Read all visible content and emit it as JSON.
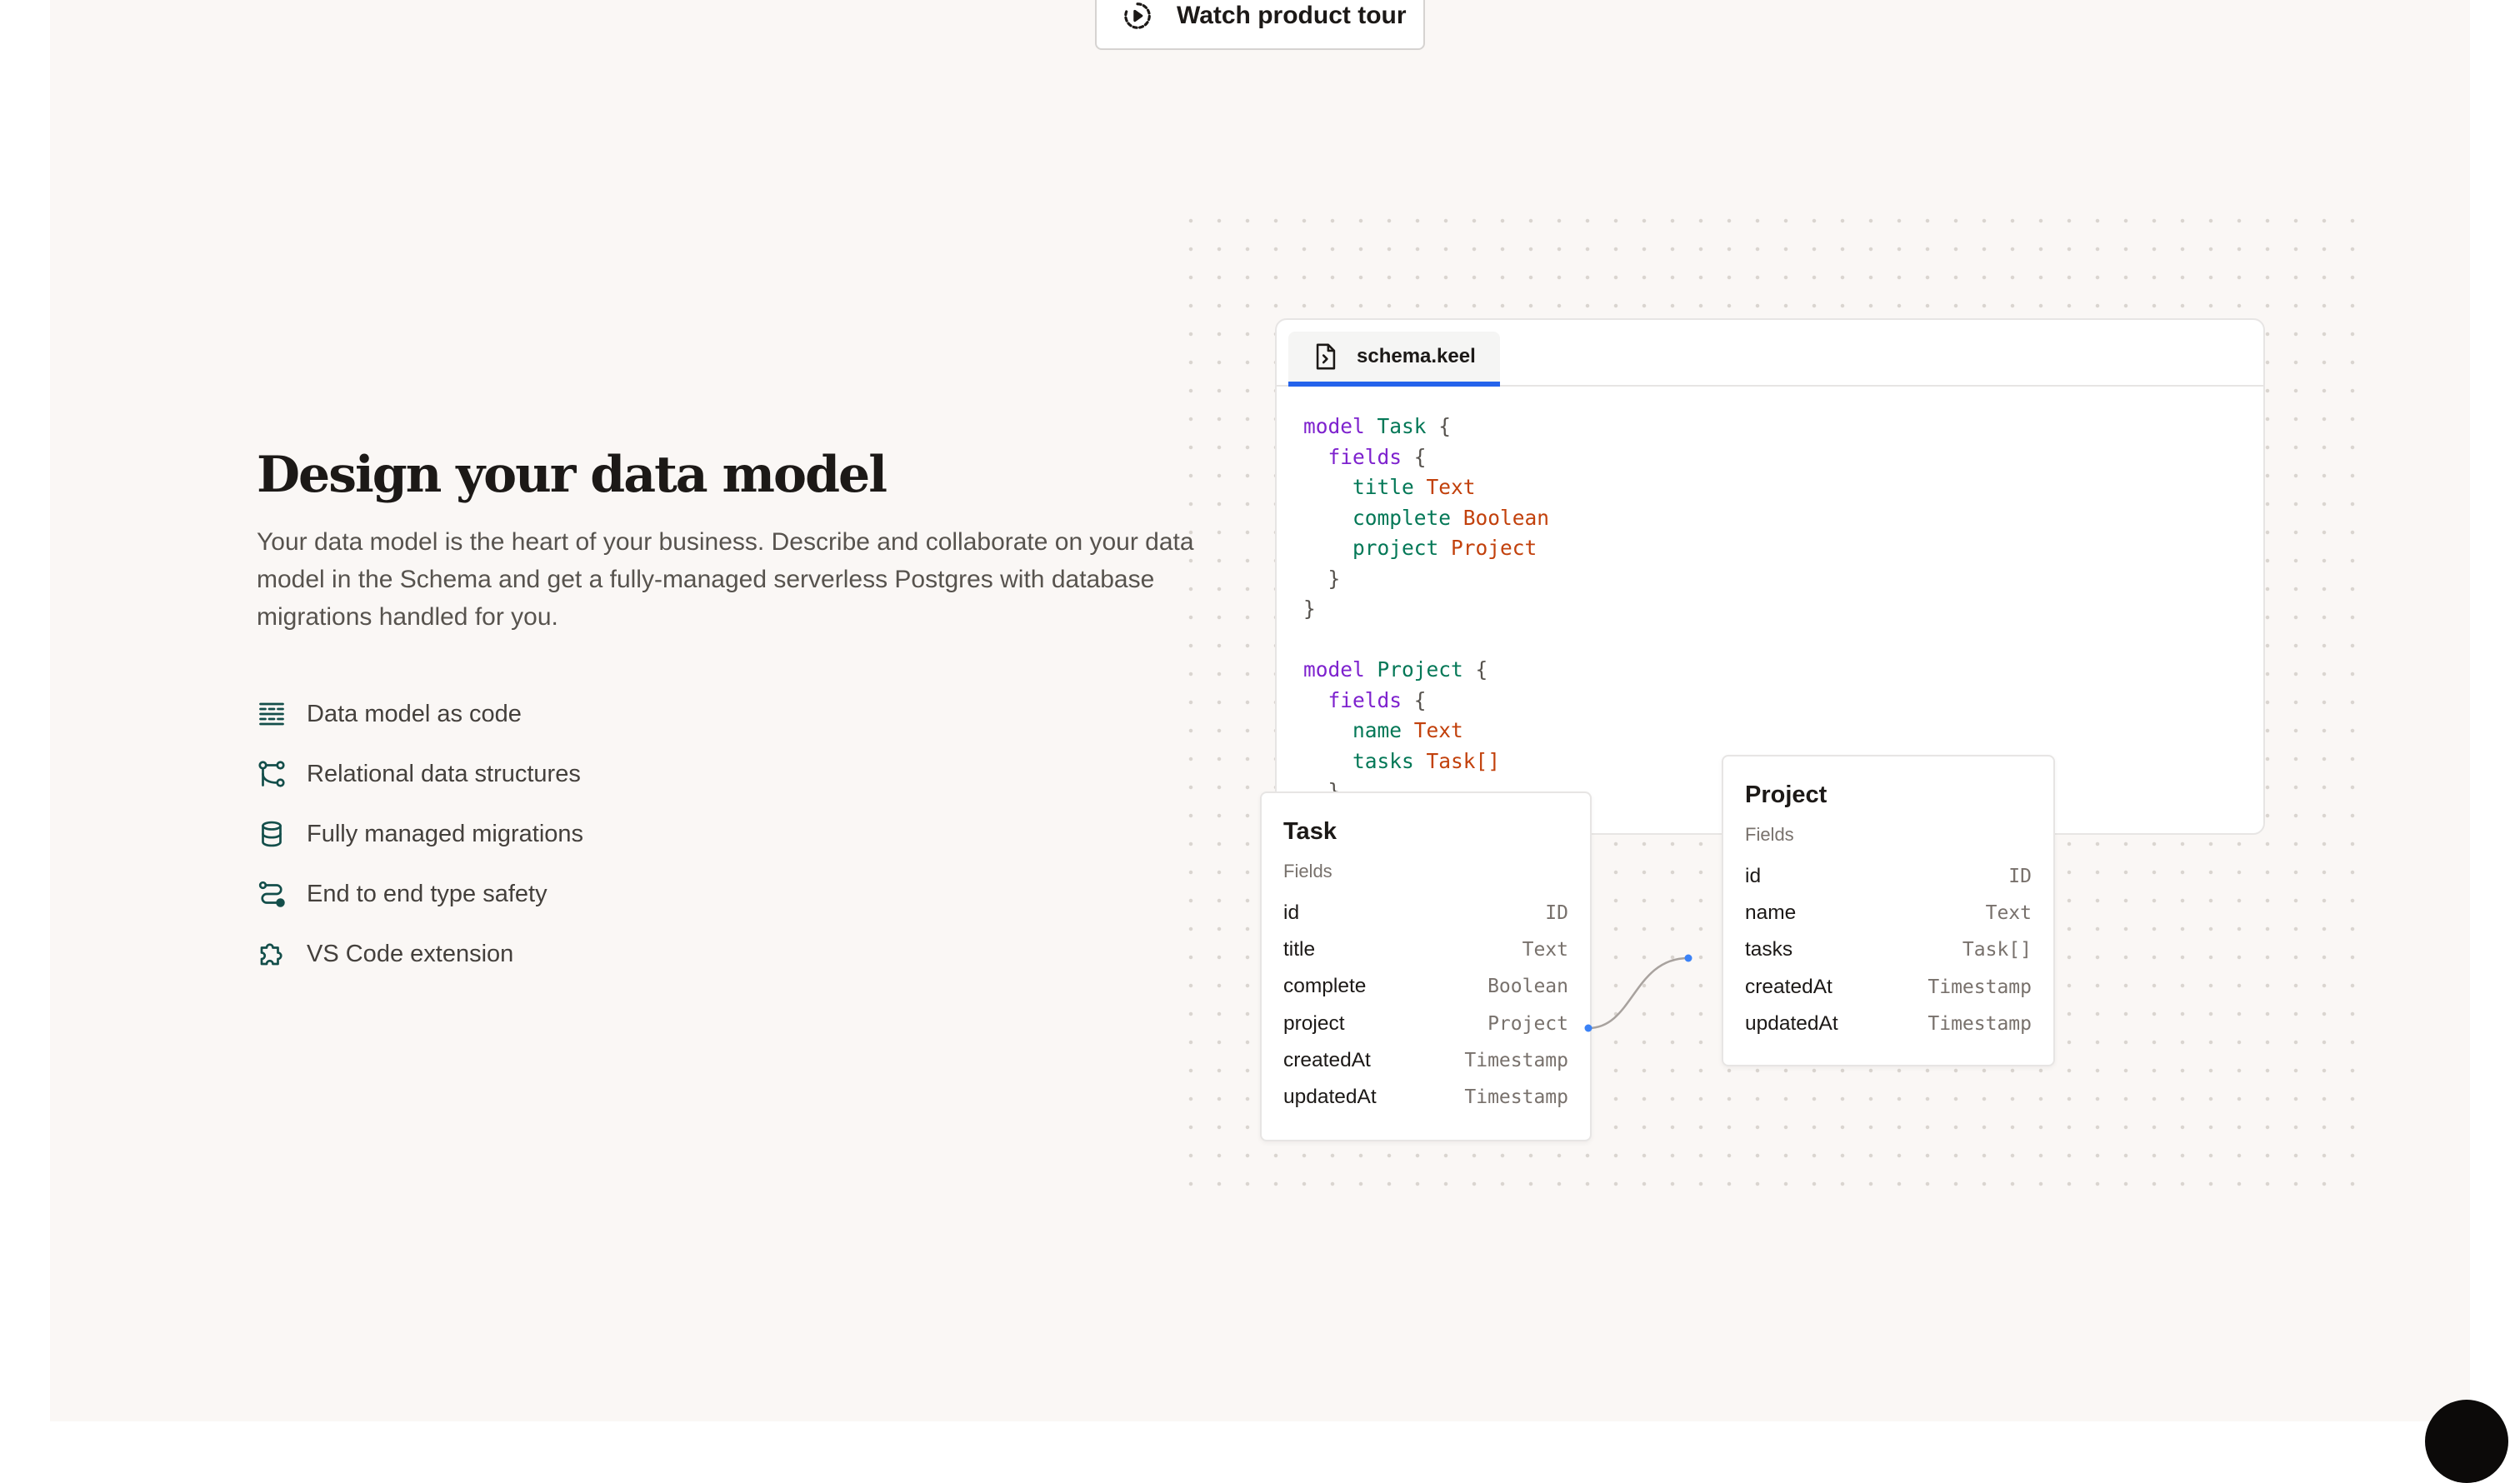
{
  "header": {
    "tour_button_label": "Watch product tour",
    "tour_icon": "play-circle-icon"
  },
  "intro": {
    "title": "Design your data model",
    "description": "Your data model is the heart of your business. Describe and collaborate on your data model in the Schema and get a fully-managed serverless Postgres with database migrations handled for you."
  },
  "features": [
    {
      "label": "Data model as code",
      "icon": "code-grid-icon"
    },
    {
      "label": "Relational data structures",
      "icon": "relations-icon"
    },
    {
      "label": "Fully managed migrations",
      "icon": "database-icon"
    },
    {
      "label": "End to end type safety",
      "icon": "route-icon"
    },
    {
      "label": "VS Code extension",
      "icon": "puzzle-icon"
    }
  ],
  "editor": {
    "tab_label": "schema.keel",
    "tab_icon": "file-code-icon",
    "code_lines": [
      {
        "t": [
          [
            "kw",
            "model "
          ],
          [
            "nm",
            "Task"
          ],
          [
            "br",
            " {"
          ]
        ]
      },
      {
        "t": [
          [
            "br",
            "  "
          ],
          [
            "kw",
            "fields"
          ],
          [
            "br",
            " {"
          ]
        ]
      },
      {
        "t": [
          [
            "br",
            "    "
          ],
          [
            "nm",
            "title"
          ],
          [
            "br",
            " "
          ],
          [
            "ty",
            "Text"
          ]
        ]
      },
      {
        "t": [
          [
            "br",
            "    "
          ],
          [
            "nm",
            "complete"
          ],
          [
            "br",
            " "
          ],
          [
            "ty",
            "Boolean"
          ]
        ]
      },
      {
        "t": [
          [
            "br",
            "    "
          ],
          [
            "nm",
            "project"
          ],
          [
            "br",
            " "
          ],
          [
            "ty",
            "Project"
          ]
        ]
      },
      {
        "t": [
          [
            "br",
            "  }"
          ]
        ]
      },
      {
        "t": [
          [
            "br",
            "}"
          ]
        ]
      },
      {
        "t": [
          [
            "br",
            ""
          ]
        ]
      },
      {
        "t": [
          [
            "kw",
            "model "
          ],
          [
            "nm",
            "Project"
          ],
          [
            "br",
            " {"
          ]
        ]
      },
      {
        "t": [
          [
            "br",
            "  "
          ],
          [
            "kw",
            "fields"
          ],
          [
            "br",
            " {"
          ]
        ]
      },
      {
        "t": [
          [
            "br",
            "    "
          ],
          [
            "nm",
            "name"
          ],
          [
            "br",
            " "
          ],
          [
            "ty",
            "Text"
          ]
        ]
      },
      {
        "t": [
          [
            "br",
            "    "
          ],
          [
            "nm",
            "tasks"
          ],
          [
            "br",
            " "
          ],
          [
            "ty",
            "Task[]"
          ]
        ]
      },
      {
        "t": [
          [
            "br",
            "  }"
          ]
        ]
      }
    ]
  },
  "models": {
    "task": {
      "title": "Task",
      "subtitle": "Fields",
      "fields": [
        {
          "name": "id",
          "type": "ID"
        },
        {
          "name": "title",
          "type": "Text"
        },
        {
          "name": "complete",
          "type": "Boolean"
        },
        {
          "name": "project",
          "type": "Project"
        },
        {
          "name": "createdAt",
          "type": "Timestamp"
        },
        {
          "name": "updatedAt",
          "type": "Timestamp"
        }
      ]
    },
    "project": {
      "title": "Project",
      "subtitle": "Fields",
      "fields": [
        {
          "name": "id",
          "type": "ID"
        },
        {
          "name": "name",
          "type": "Text"
        },
        {
          "name": "tasks",
          "type": "Task[]"
        },
        {
          "name": "createdAt",
          "type": "Timestamp"
        },
        {
          "name": "updatedAt",
          "type": "Timestamp"
        }
      ]
    }
  },
  "colors": {
    "page_bg": "#faf7f5",
    "keyword": "#7e22ce",
    "identifier": "#047857",
    "type": "#c2410c",
    "tab_accent": "#2563eb",
    "icon_green": "#134e4a",
    "connector": "#a8a29e",
    "connector_dot": "#3b82f6"
  }
}
